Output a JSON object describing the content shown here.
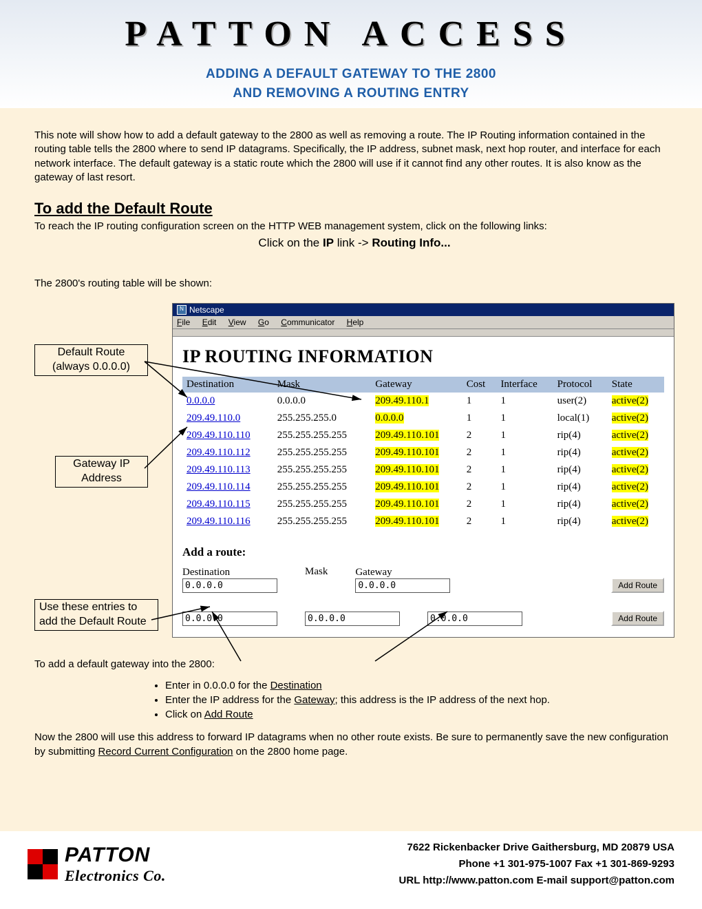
{
  "header": {
    "title": "PATTON   ACCESS",
    "sub1": "ADDING A DEFAULT GATEWAY TO THE 2800",
    "sub2": "AND REMOVING A ROUTING ENTRY"
  },
  "intro": "This note will show how to add a default gateway to the 2800 as well as removing a route.  The IP Routing information contained in the routing table tells the 2800 where to send IP datagrams.  Specifically, the IP address, subnet mask, next hop router, and interface for each network interface.  The default gateway is a static route which the 2800 will use if it cannot find any other routes.  It is also know as the gateway of last resort.",
  "section_title": "To add the Default Route",
  "para1": "To reach the IP routing configuration screen on the HTTP WEB management system, click on the following links:",
  "center_line_pre": "Click on the ",
  "center_line_b1": "IP",
  "center_line_mid": " link -> ",
  "center_line_b2": "Routing Info...",
  "table_caption": "The 2800's routing table will be shown:",
  "callouts": {
    "default": "Default Route (always 0.0.0.0)",
    "gateway": "Gateway IP Address",
    "entries": "Use these entries to add the Default Route"
  },
  "browser": {
    "title": "Netscape",
    "menu": [
      "File",
      "Edit",
      "View",
      "Go",
      "Communicator",
      "Help"
    ]
  },
  "sc_heading": "IP ROUTING INFORMATION",
  "columns": [
    "Destination",
    "Mask",
    "Gateway",
    "Cost",
    "Interface",
    "Protocol",
    "State"
  ],
  "rows": [
    {
      "dest": "0.0.0.0",
      "mask": "0.0.0.0",
      "gw": "209.49.110.1",
      "cost": "1",
      "if": "1",
      "proto": "user(2)",
      "state": "active(2)",
      "d_link": true
    },
    {
      "dest": "209.49.110.0",
      "mask": "255.255.255.0",
      "gw": "0.0.0.0",
      "cost": "1",
      "if": "1",
      "proto": "local(1)",
      "state": "active(2)",
      "d_link": true
    },
    {
      "dest": "209.49.110.110",
      "mask": "255.255.255.255",
      "gw": "209.49.110.101",
      "cost": "2",
      "if": "1",
      "proto": "rip(4)",
      "state": "active(2)",
      "d_link": true
    },
    {
      "dest": "209.49.110.112",
      "mask": "255.255.255.255",
      "gw": "209.49.110.101",
      "cost": "2",
      "if": "1",
      "proto": "rip(4)",
      "state": "active(2)",
      "d_link": true
    },
    {
      "dest": "209.49.110.113",
      "mask": "255.255.255.255",
      "gw": "209.49.110.101",
      "cost": "2",
      "if": "1",
      "proto": "rip(4)",
      "state": "active(2)",
      "d_link": true
    },
    {
      "dest": "209.49.110.114",
      "mask": "255.255.255.255",
      "gw": "209.49.110.101",
      "cost": "2",
      "if": "1",
      "proto": "rip(4)",
      "state": "active(2)",
      "d_link": true
    },
    {
      "dest": "209.49.110.115",
      "mask": "255.255.255.255",
      "gw": "209.49.110.101",
      "cost": "2",
      "if": "1",
      "proto": "rip(4)",
      "state": "active(2)",
      "d_link": true
    },
    {
      "dest": "209.49.110.116",
      "mask": "255.255.255.255",
      "gw": "209.49.110.101",
      "cost": "2",
      "if": "1",
      "proto": "rip(4)",
      "state": "active(2)",
      "d_link": true
    }
  ],
  "add_route_h": "Add a route:",
  "form_labels": {
    "dest": "Destination",
    "mask": "Mask",
    "gw": "Gateway"
  },
  "form_rows": [
    {
      "dest": "0.0.0.0",
      "mask": "",
      "gw": "0.0.0.0",
      "btn": "Add Route"
    },
    {
      "dest": "0.0.0.0",
      "mask": "0.0.0.0",
      "gw": "0.0.0.0",
      "btn": "Add Route"
    }
  ],
  "after_text": "To add a default gateway into the 2800:",
  "bullets": [
    {
      "pre": "Enter in 0.0.0.0 for the ",
      "u": "Destination",
      "post": ""
    },
    {
      "pre": "Enter the IP address for the ",
      "u": "Gateway",
      "post": "; this address is the IP address of the next hop."
    },
    {
      "pre": "Click on ",
      "u": "Add Route",
      "post": ""
    }
  ],
  "closing_pre": "Now the 2800 will use this address to forward IP datagrams when no other route exists.  Be sure to permanently save the new configuration by submitting ",
  "closing_u": "Record Current Configuration",
  "closing_post": " on the 2800 home page.",
  "footer": {
    "logo1": "PATTON",
    "logo2": "Electronics Co.",
    "addr": "7622 Rickenbacker Drive Gaithersburg, MD  20879 USA",
    "phone": "Phone +1 301-975-1007     Fax +1 301-869-9293",
    "url": "URL http://www.patton.com    E-mail support@patton.com"
  }
}
